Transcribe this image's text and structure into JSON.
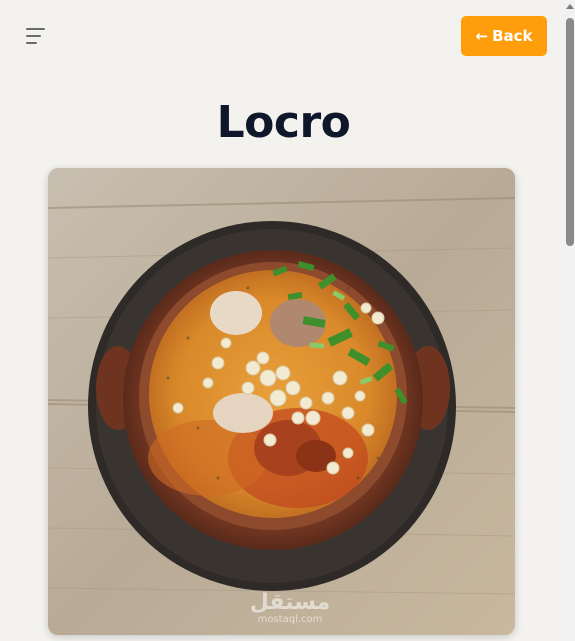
{
  "header": {
    "menu_icon": "hamburger-menu-icon",
    "back_button": {
      "arrow": "←",
      "label": "Back"
    },
    "accent_color": "#ff9e0d"
  },
  "main": {
    "title": "Locro",
    "image": {
      "subject": "bowl-of-locro",
      "watermark_mark": "مستقل",
      "watermark_domain": "mostaql.com"
    }
  },
  "colors": {
    "background": "#f3f2ef",
    "title": "#0f172a",
    "button_text": "#ffffff"
  }
}
